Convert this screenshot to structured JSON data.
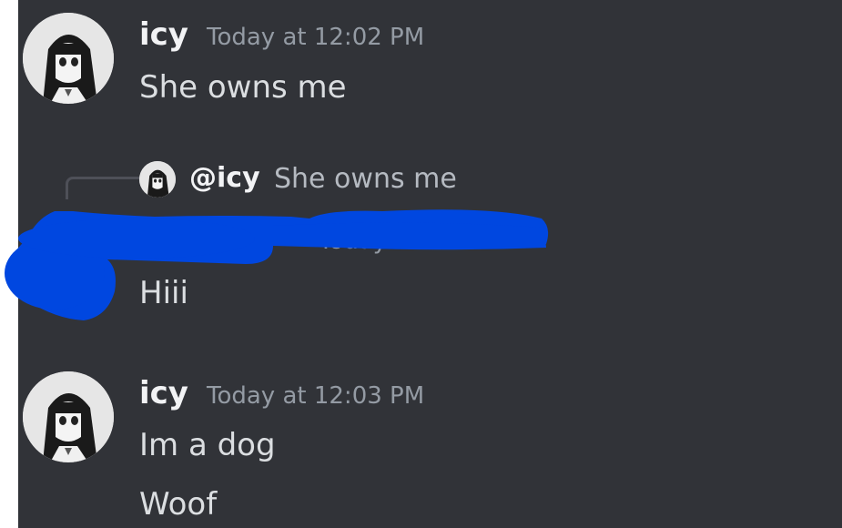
{
  "colors": {
    "background": "#313338",
    "username": "#f2f3f5",
    "timestamp": "#949ba4",
    "message": "#dbdee1",
    "redaction": "#0047e0"
  },
  "messages": [
    {
      "author": "icy",
      "timestamp": "Today at 12:02 PM",
      "lines": [
        "She owns me"
      ]
    },
    {
      "reply_to": {
        "mention": "@icy",
        "text": "She owns me"
      },
      "lines": [
        "Hiii"
      ]
    },
    {
      "author": "icy",
      "timestamp": "Today at 12:03 PM",
      "lines": [
        "Im a dog",
        "Woof"
      ]
    }
  ],
  "icons": {
    "avatar": "anime-girl-avatar",
    "redaction": "blue-scribble-redaction"
  }
}
